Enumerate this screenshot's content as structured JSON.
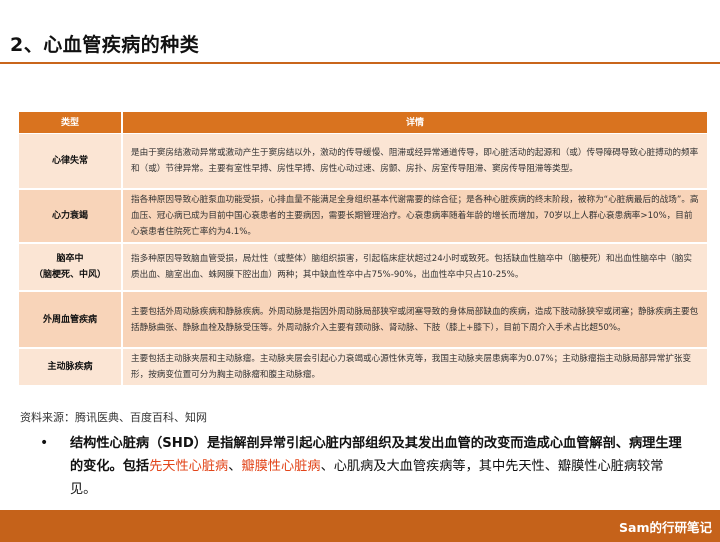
{
  "page": {
    "title": "2、心血管疾病的种类"
  },
  "table": {
    "headers": [
      "类型",
      "详情"
    ],
    "rows": [
      {
        "type": "心律失常",
        "type_sub": "",
        "detail": "是由于窦房结激动异常或激动产生于窦房结以外，激动的传导缓慢、阻滞或经异常通道传导，即心脏活动的起源和（或）传导障碍导致心脏搏动的频率和（或）节律异常。主要有室性早搏、房性早搏、房性心动过速、房颤、房扑、房室传导阻滞、窦房传导阻滞等类型。"
      },
      {
        "type": "心力衰竭",
        "type_sub": "",
        "detail": "指各种原因导致心脏泵血功能受损，心排血量不能满足全身组织基本代谢需要的综合征；是各种心脏疾病的终末阶段，被称为“心脏病最后的战场”。高血压、冠心病已成为目前中国心衰患者的主要病因，需要长期管理治疗。心衰患病率随着年龄的增长而增加，70岁以上人群心衰患病率>10%，目前心衰患者住院死亡率约为4.1%。"
      },
      {
        "type": "脑卒中",
        "type_sub": "（脑梗死、中风）",
        "detail": "指多种原因导致脑血管受损，局灶性（或整体）脑组织损害，引起临床症状超过24小时或致死。包括缺血性脑卒中（脑梗死）和出血性脑卒中（脑实质出血、脑室出血、蛛网膜下腔出血）两种；其中缺血性卒中占75%-90%，出血性卒中只占10-25%。"
      },
      {
        "type": "外周血管疾病",
        "type_sub": "",
        "detail": "主要包括外周动脉疾病和静脉疾病。外周动脉是指因外周动脉局部狭窄或闭塞导致的身体局部缺血的疾病，造成下肢动脉狭窄或闭塞；静脉疾病主要包括静脉曲张、静脉血栓及静脉受压等。外周动脉介入主要有颈动脉、肾动脉、下肢（膝上+膝下），目前下周介入手术占比超50%。"
      },
      {
        "type": "主动脉疾病",
        "type_sub": "",
        "detail": "主要包括主动脉夹层和主动脉瘤。主动脉夹层会引起心力衰竭或心源性休克等，我国主动脉夹层患病率为0.07%；主动脉瘤指主动脉局部异常扩张变形，按病变位置可分为胸主动脉瘤和腹主动脉瘤。"
      }
    ]
  },
  "source": "资料来源：腾讯医典、百度百科、知网",
  "bullet": {
    "term": "结构性心脏病（SHD）",
    "text_1": "是指解剖异常引起心脏内部组织及其发出血管的改变而造成心血管解剖、病理生理的变化。包括",
    "highlight_1": "先天性心脏病",
    "sep": "、",
    "highlight_2": "瓣膜性心脏病",
    "text_2": "、心肌病及大血管疾病等，其中先天性、瓣膜性心脏病较常见。"
  },
  "footer": {
    "brand": "Sam的行研笔记"
  },
  "colors": {
    "accent": "#d9731f",
    "row_light": "#fbe5d4",
    "row_dark": "#f8d4b9",
    "highlight": "#e2451a",
    "footer": "#c5621a"
  }
}
